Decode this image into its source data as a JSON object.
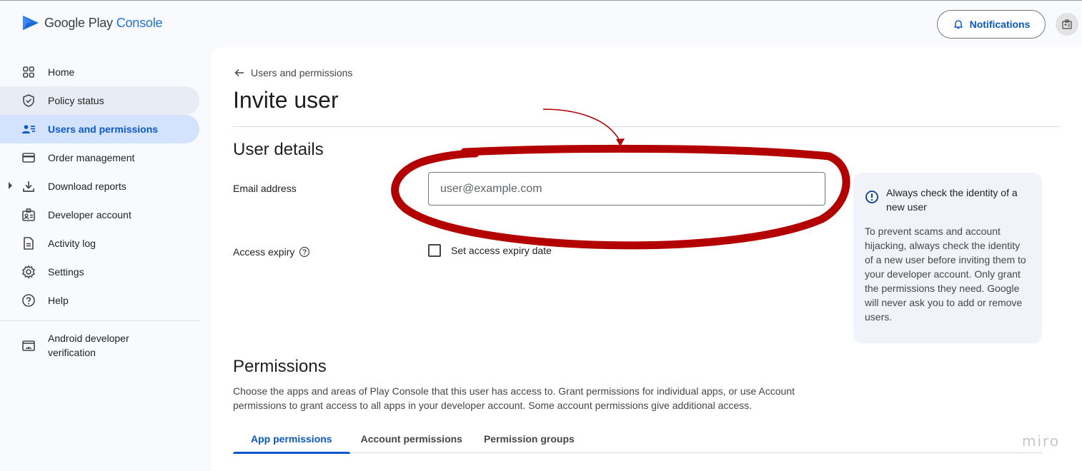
{
  "app": {
    "logo_google_play": "Google Play",
    "logo_console": "Console",
    "notifications_label": "Notifications"
  },
  "sidebar": {
    "items": [
      {
        "label": "Home",
        "icon": "grid-icon"
      },
      {
        "label": "Policy status",
        "icon": "shield-icon"
      },
      {
        "label": "Users and permissions",
        "icon": "users-icon"
      },
      {
        "label": "Order management",
        "icon": "card-icon"
      },
      {
        "label": "Download reports",
        "icon": "download-icon"
      },
      {
        "label": "Developer account",
        "icon": "badge-icon"
      },
      {
        "label": "Activity log",
        "icon": "document-icon"
      },
      {
        "label": "Settings",
        "icon": "gear-icon"
      },
      {
        "label": "Help",
        "icon": "help-icon"
      },
      {
        "label": "Android developer verification",
        "icon": "android-icon"
      }
    ],
    "active_item": "Users and permissions",
    "hover_item": "Policy status"
  },
  "main": {
    "back_link": "Users and permissions",
    "page_title": "Invite user",
    "user_details_title": "User details",
    "email_label": "Email address",
    "email_value": "",
    "email_placeholder": "user@example.com",
    "access_expiry_label": "Access expiry",
    "set_expiry_label": "Set access expiry date",
    "set_expiry_checked": false,
    "info_card": {
      "title": "Always check the identity of a new user",
      "body": "To prevent scams and account hijacking, always check the identity of a new user before inviting them to your developer account. Only grant the permissions they need. Google will never ask you to add or remove users."
    },
    "permissions_title": "Permissions",
    "permissions_desc": "Choose the apps and areas of Play Console that this user has access to. Grant permissions for individual apps, or use Account permissions to grant access to all apps in your developer account. Some account permissions give additional access.",
    "tabs": [
      "App permissions",
      "Account permissions",
      "Permission groups"
    ],
    "active_tab": "App permissions"
  },
  "watermark": "miro",
  "colors": {
    "accent": "#0b57d0",
    "active_nav_bg": "#d3e3fd",
    "annotation_red": "#b30000"
  }
}
